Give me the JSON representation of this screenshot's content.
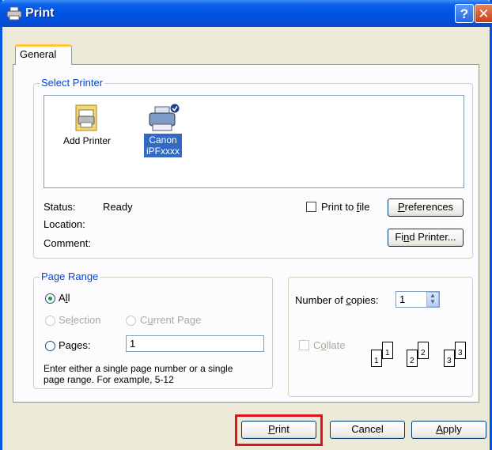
{
  "window": {
    "title": "Print",
    "help_label": "?",
    "close_label": "✕"
  },
  "tabs": [
    {
      "label": "General"
    }
  ],
  "select_printer": {
    "label": "Select Printer",
    "printers": [
      {
        "name": "Add Printer",
        "icon": "add-printer-icon"
      },
      {
        "name_line1": "Canon",
        "name_line2": "iPFxxxx",
        "icon": "printer-icon",
        "selected": true,
        "default": true
      }
    ],
    "status_label": "Status:",
    "status_value": "Ready",
    "location_label": "Location:",
    "comment_label": "Comment:",
    "print_to_file": {
      "pre": "Print to ",
      "u": "f",
      "post": "ile",
      "checked": false
    },
    "preferences": {
      "u": "P",
      "post": "references"
    },
    "find_printer": {
      "pre": "Fi",
      "u": "n",
      "post": "d Printer..."
    }
  },
  "page_range": {
    "label": "Page Range",
    "all": {
      "pre": "A",
      "u": "l",
      "post": "l",
      "selected": true
    },
    "selection": {
      "pre": "Se",
      "u": "l",
      "post": "ection"
    },
    "current_page": {
      "pre": "C",
      "u": "u",
      "post": "rrent Page"
    },
    "pages": {
      "pre": "Pa",
      "u": "g",
      "post": "es:",
      "value": "1"
    },
    "hint_line1": "Enter either a single page number or a single",
    "hint_line2": "page range.  For example, 5-12"
  },
  "copies": {
    "label_pre": "Number of ",
    "label_u": "c",
    "label_post": "opies:",
    "value": "1",
    "collate": {
      "pre": "C",
      "u": "o",
      "post": "llate",
      "checked": false
    },
    "collate_pages": [
      "1",
      "1",
      "2",
      "2",
      "3",
      "3"
    ]
  },
  "buttons": {
    "print": {
      "u": "P",
      "post": "rint"
    },
    "cancel": "Cancel",
    "apply": {
      "u": "A",
      "post": "pply"
    }
  },
  "colors": {
    "title_bar": "#0054e3",
    "group_label": "#0046d5",
    "highlight": "#e0141e",
    "selection": "#316ac5"
  }
}
